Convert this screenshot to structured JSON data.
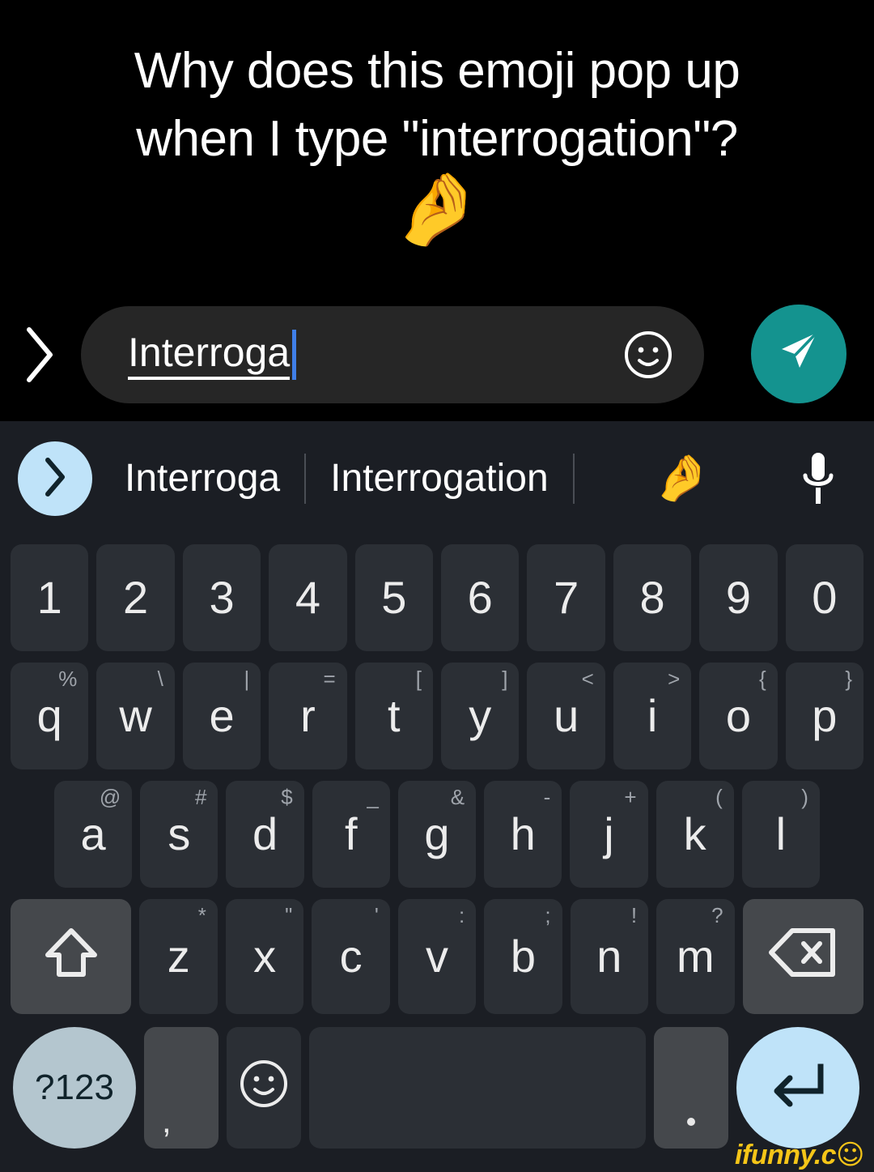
{
  "meme": {
    "caption": "Why does this emoji pop up\nwhen I type \"interrogation\"?",
    "emoji": "🤌",
    "watermark_text": "ifunny.c",
    "watermark_smiley": "☺",
    "watermark_color": "#f5c518"
  },
  "chat": {
    "expand_icon": "chevron-right-icon",
    "composing_text": "Interroga",
    "emoji_button_icon": "smiley-face-icon",
    "send_button_icon": "send-paper-plane-icon",
    "send_button_color": "#14938f",
    "caret_color": "#3f7fe8",
    "input_background": "#262626"
  },
  "keyboard": {
    "background": "#1b1e24",
    "key_color": "#2b2f35",
    "key_light_color": "#45484c",
    "accent_key_color": "#bfe3f9",
    "sym_key_color": "#b4c6cf",
    "suggestions": {
      "expand_icon": "chevron-right-icon",
      "items": [
        "Interroga",
        "Interrogation"
      ],
      "emoji_suggestion": "🤌",
      "mic_icon": "microphone-icon"
    },
    "rows": {
      "numbers": [
        {
          "main": "1"
        },
        {
          "main": "2"
        },
        {
          "main": "3"
        },
        {
          "main": "4"
        },
        {
          "main": "5"
        },
        {
          "main": "6"
        },
        {
          "main": "7"
        },
        {
          "main": "8"
        },
        {
          "main": "9"
        },
        {
          "main": "0"
        }
      ],
      "top": [
        {
          "main": "q",
          "sub": "%"
        },
        {
          "main": "w",
          "sub": "\\"
        },
        {
          "main": "e",
          "sub": "|"
        },
        {
          "main": "r",
          "sub": "="
        },
        {
          "main": "t",
          "sub": "["
        },
        {
          "main": "y",
          "sub": "]"
        },
        {
          "main": "u",
          "sub": "<"
        },
        {
          "main": "i",
          "sub": ">"
        },
        {
          "main": "o",
          "sub": "{"
        },
        {
          "main": "p",
          "sub": "}"
        }
      ],
      "home": [
        {
          "main": "a",
          "sub": "@"
        },
        {
          "main": "s",
          "sub": "#"
        },
        {
          "main": "d",
          "sub": "$"
        },
        {
          "main": "f",
          "sub": "_"
        },
        {
          "main": "g",
          "sub": "&"
        },
        {
          "main": "h",
          "sub": "-"
        },
        {
          "main": "j",
          "sub": "+"
        },
        {
          "main": "k",
          "sub": "("
        },
        {
          "main": "l",
          "sub": ")"
        }
      ],
      "bottom": [
        {
          "main": "z",
          "sub": "*"
        },
        {
          "main": "x",
          "sub": "\""
        },
        {
          "main": "c",
          "sub": "'"
        },
        {
          "main": "v",
          "sub": ":"
        },
        {
          "main": "b",
          "sub": ";"
        },
        {
          "main": "n",
          "sub": "!"
        },
        {
          "main": "m",
          "sub": "?"
        }
      ],
      "shift_icon": "shift-arrow-icon",
      "backspace_icon": "backspace-icon",
      "space_row": {
        "symbols_label": "?123",
        "comma_label": ",",
        "emoji_icon": "smiley-face-icon",
        "space_label": "",
        "period_label": ".",
        "enter_icon": "enter-return-icon"
      }
    }
  }
}
